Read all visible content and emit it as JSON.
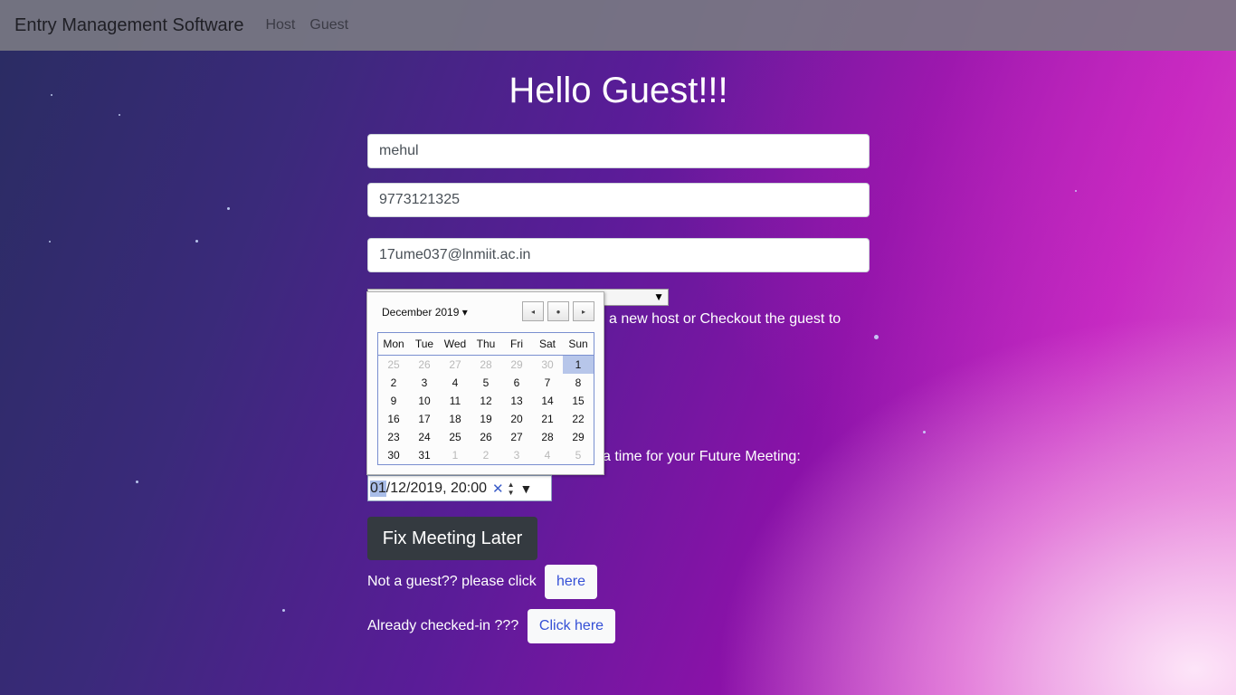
{
  "navbar": {
    "brand": "Entry Management Software",
    "links": [
      "Host",
      "Guest"
    ]
  },
  "title": "Hello Guest!!!",
  "form": {
    "name_value": "mehul",
    "phone_value": "9773121325",
    "email_value": "17ume037@lnmiit.ac.in",
    "select_arrow": "▼",
    "partial_text_1": "a new host or Checkout the guest to",
    "partial_text_2": "a time for your Future Meeting:",
    "datetime": {
      "day": "01",
      "rest": "/12/2019, 20:00",
      "clear": "✕",
      "spin_up": "▲",
      "spin_down": "▼",
      "dropdown": "▼"
    }
  },
  "calendar": {
    "month_label": "December 2019",
    "month_caret": "▾",
    "nav_prev": "◂",
    "nav_today": "●",
    "nav_next": "▸",
    "weekdays": [
      "Mon",
      "Tue",
      "Wed",
      "Thu",
      "Fri",
      "Sat",
      "Sun"
    ],
    "weeks": [
      [
        "25",
        "26",
        "27",
        "28",
        "29",
        "30",
        "1"
      ],
      [
        "2",
        "3",
        "4",
        "5",
        "6",
        "7",
        "8"
      ],
      [
        "9",
        "10",
        "11",
        "12",
        "13",
        "14",
        "15"
      ],
      [
        "16",
        "17",
        "18",
        "19",
        "20",
        "21",
        "22"
      ],
      [
        "23",
        "24",
        "25",
        "26",
        "27",
        "28",
        "29"
      ],
      [
        "30",
        "31",
        "1",
        "2",
        "3",
        "4",
        "5"
      ]
    ],
    "other_month": [
      [
        0,
        0
      ],
      [
        0,
        1
      ],
      [
        0,
        2
      ],
      [
        0,
        3
      ],
      [
        0,
        4
      ],
      [
        0,
        5
      ],
      [
        5,
        2
      ],
      [
        5,
        3
      ],
      [
        5,
        4
      ],
      [
        5,
        5
      ],
      [
        5,
        6
      ]
    ],
    "selected": [
      0,
      6
    ]
  },
  "buttons": {
    "fix_meeting": "Fix Meeting Later",
    "not_guest_text": "Not a guest?? please click",
    "not_guest_link": "here",
    "checked_in_text": "Already checked-in ???",
    "checked_in_link": "Click here"
  }
}
